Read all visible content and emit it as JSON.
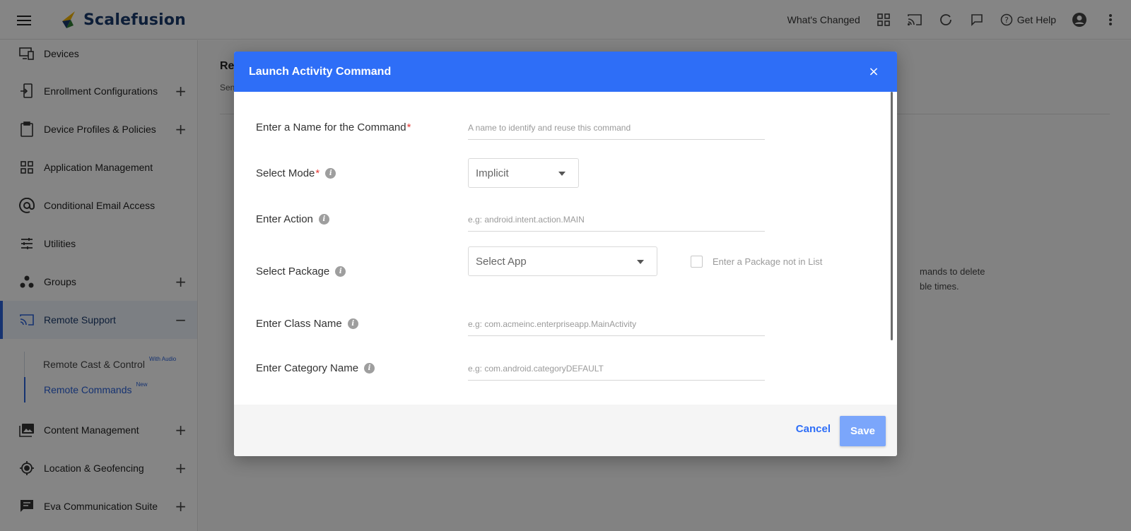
{
  "app": {
    "logo_text": "Scalefusion"
  },
  "topbar": {
    "whats_changed": "What's Changed",
    "get_help": "Get Help",
    "icons": [
      "grid-icon",
      "cast-icon",
      "refresh-icon",
      "chat-icon",
      "help-icon",
      "account-icon",
      "more-vert-icon"
    ]
  },
  "sidebar": {
    "items": [
      {
        "label": "Devices",
        "icon": "devices-icon",
        "expand": ""
      },
      {
        "label": "Enrollment Configurations",
        "icon": "enrollment-icon",
        "expand": "+"
      },
      {
        "label": "Device Profiles & Policies",
        "icon": "clipboard-icon",
        "expand": "+"
      },
      {
        "label": "Application Management",
        "icon": "apps-icon",
        "expand": ""
      },
      {
        "label": "Conditional Email Access",
        "icon": "at-icon",
        "expand": ""
      },
      {
        "label": "Utilities",
        "icon": "sliders-icon",
        "expand": ""
      },
      {
        "label": "Groups",
        "icon": "groups-icon",
        "expand": "+"
      },
      {
        "label": "Remote Support",
        "icon": "cast-icon",
        "expand": "−"
      },
      {
        "label": "Content Management",
        "icon": "photos-icon",
        "expand": "+"
      },
      {
        "label": "Location & Geofencing",
        "icon": "location-icon",
        "expand": "+"
      },
      {
        "label": "Eva Communication Suite",
        "icon": "message-icon",
        "expand": "+"
      }
    ],
    "subitems": [
      {
        "label": "Remote Cast & Control",
        "badge": "With Audio"
      },
      {
        "label": "Remote Commands",
        "badge": "New"
      }
    ]
  },
  "main": {
    "title": "Re",
    "subtitle": "Sen",
    "paragraph_line1": "mands to delete",
    "paragraph_line2": "ble times."
  },
  "modal": {
    "title": "Launch Activity Command",
    "close": "×",
    "fields": {
      "name_label": "Enter a Name for the Command",
      "name_placeholder": "A name to identify and reuse this command",
      "mode_label": "Select Mode",
      "mode_value": "Implicit",
      "action_label": "Enter Action",
      "action_placeholder": "e.g: android.intent.action.MAIN",
      "package_label": "Select Package",
      "package_value": "Select App",
      "package_checkbox_label": "Enter a Package not in List",
      "class_label": "Enter Class Name",
      "class_placeholder": "e.g: com.acmeinc.enterpriseapp.MainActivity",
      "category_label": "Enter Category Name",
      "category_placeholder": "e.g: com.android.categoryDEFAULT"
    },
    "required_mark": "*",
    "info_glyph": "i",
    "cancel_label": "Cancel",
    "save_label": "Save"
  },
  "colors": {
    "header_blue": "#2e6ef7",
    "save_button": "#7ba6fb",
    "required_red": "#e53935",
    "brand_navy": "#1a3a6b"
  }
}
